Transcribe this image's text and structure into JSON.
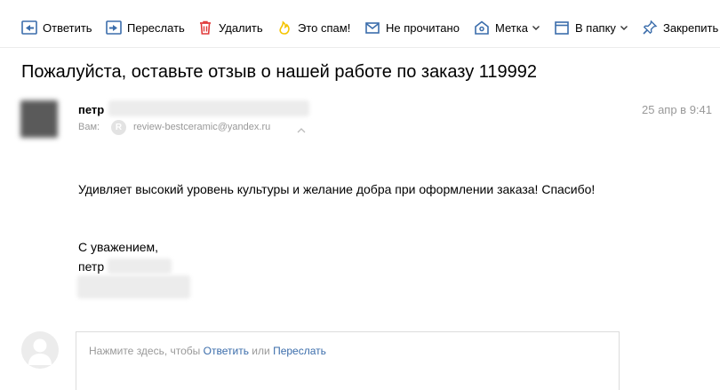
{
  "toolbar": {
    "reply_label": "Ответить",
    "forward_label": "Переслать",
    "delete_label": "Удалить",
    "spam_label": "Это спам!",
    "unread_label": "Не прочитано",
    "label_label": "Метка",
    "folder_label": "В папку",
    "pin_label": "Закрепить"
  },
  "message": {
    "subject": "Пожалуйста, оставьте отзыв о нашей работе по заказу 119992",
    "sender_name": "петр",
    "to_label": "Вам:",
    "to_badge": "R",
    "to_address": "review-bestceramic@yandex.ru",
    "date": "25 апр в 9:41",
    "body_line1": "Удивляет высокий уровень культуры и желание добра при оформлении заказа! Спасибо!",
    "signoff": "С уважением,",
    "signature_name": "петр"
  },
  "reply": {
    "hint_prefix": "Нажмите здесь, чтобы",
    "reply_link": "Ответить",
    "hint_or": "или",
    "forward_link": "Переслать"
  },
  "colors": {
    "accent_blue": "#3b6dab",
    "delete_red": "#e03a3a",
    "spam_yellow": "#f5c400",
    "muted_text": "#999999"
  }
}
